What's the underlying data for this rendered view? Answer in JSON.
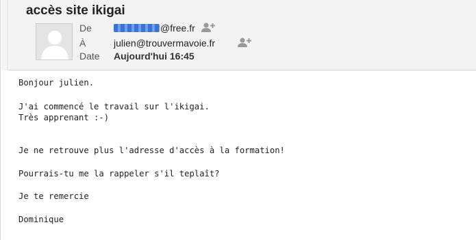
{
  "email": {
    "subject": "accès site ikigai",
    "from": {
      "label": "De",
      "address_suffix": "@free.fr",
      "redacted": true
    },
    "to": {
      "label": "À",
      "address": "julien@trouvermavoie.fr"
    },
    "date": {
      "label": "Date",
      "value": "Aujourd'hui 16:45"
    }
  },
  "icons": {
    "avatar": "default-user-avatar",
    "add_contact": "add-contact-icon"
  },
  "body_lines": [
    "Bonjour julien.",
    "J'ai commencé le travail sur l'ikigai.",
    "Très apprenant :-)",
    "Je ne retrouve plus l'adresse d'accès à la formation!",
    "Pourrais-tu me la rappeler s'il teplaît?",
    "Je te remercie",
    "Dominique"
  ],
  "colors": {
    "header_bg": "#f3f3f3",
    "redaction": "#4a86e8",
    "text": "#222222"
  }
}
